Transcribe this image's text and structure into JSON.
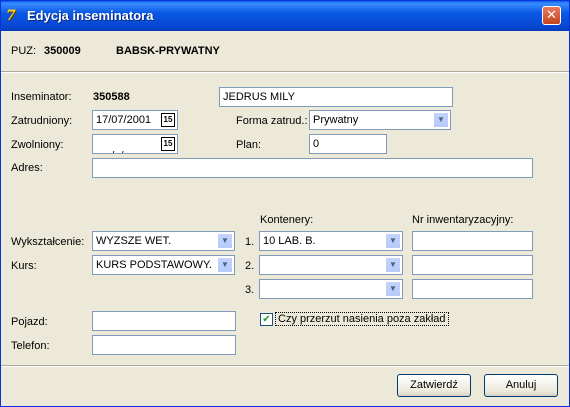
{
  "window": {
    "title": "Edycja inseminatora",
    "close_glyph": "✕",
    "app_icon": "7"
  },
  "header": {
    "puz_label": "PUZ:",
    "puz_number": "350009",
    "name": "BABSK-PRYWATNY"
  },
  "form": {
    "inseminator_label": "Inseminator:",
    "inseminator_number": "350588",
    "inseminator_name": "JEDRUS MILY",
    "hired_label": "Zatrudniony:",
    "hired_date": "17/07/2001",
    "dismissed_label": "Zwolniony:",
    "dismissed_date": " /  /",
    "calendar_glyph": "15",
    "employment_label": "Forma zatrud.:",
    "employment_value": "Prywatny",
    "plan_label": "Plan:",
    "plan_value": "0",
    "address_label": "Adres:",
    "address_value": "",
    "containers_header": "Kontenery:",
    "inventory_header": "Nr inwentaryzacyjny:",
    "education_label": "Wykształcenie:",
    "education_value": "WYZSZE WET.",
    "course_label": "Kurs:",
    "course_value": "KURS PODSTAWOWY.",
    "containers": [
      {
        "num": "1.",
        "value": "10 LAB. B.",
        "inventory": ""
      },
      {
        "num": "2.",
        "value": "",
        "inventory": ""
      },
      {
        "num": "3.",
        "value": "",
        "inventory": ""
      }
    ],
    "vehicle_label": "Pojazd:",
    "vehicle_value": "",
    "phone_label": "Telefon:",
    "phone_value": "",
    "transfer_label": "Czy przerzut nasienia poza zakład",
    "transfer_checked": true,
    "check_glyph": "✔"
  },
  "buttons": {
    "confirm": "Zatwierdź",
    "cancel": "Anuluj"
  }
}
